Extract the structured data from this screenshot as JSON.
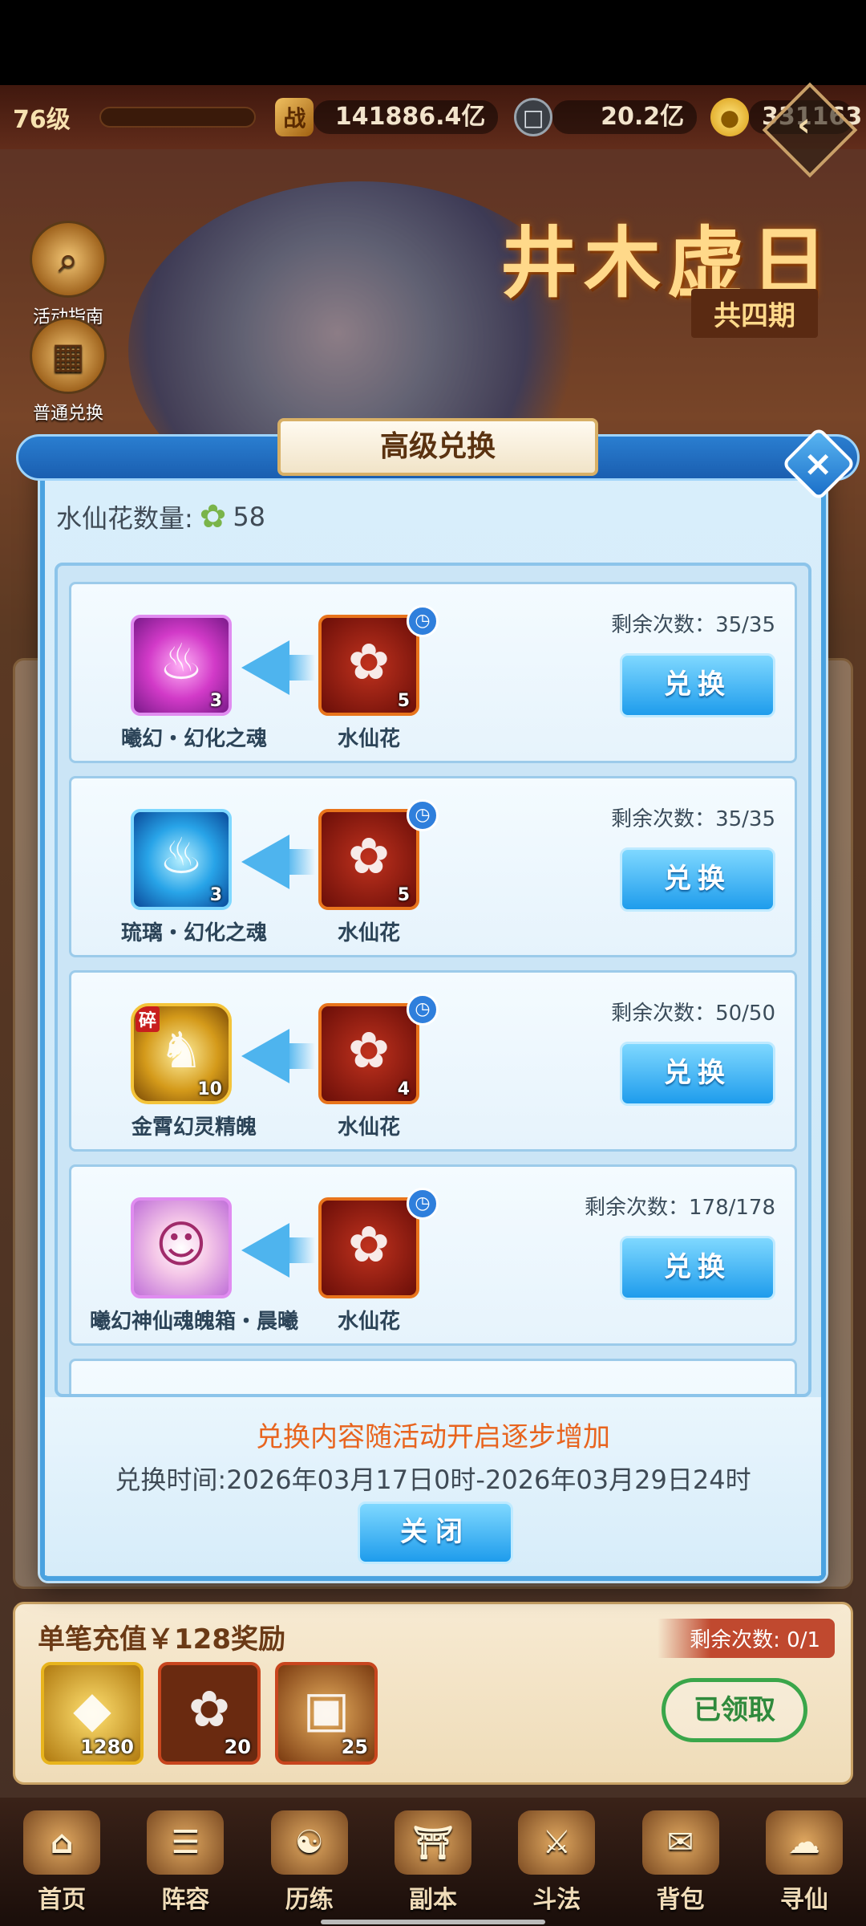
{
  "topbar": {
    "level": "76级",
    "power_value": "141886.4亿",
    "coin_value": "20.2亿",
    "gold_value": "331163"
  },
  "event": {
    "title": "井木虚日",
    "subtitle": "共四期",
    "left_icons": [
      "活动指南",
      "普通兑换"
    ]
  },
  "modal": {
    "title": "高级兑换",
    "flower_label": "水仙花数量:",
    "flower_count": "58",
    "exchange_button": "兑换",
    "rows": [
      {
        "target_name": "曦幻・幻化之魂",
        "target_count": "3",
        "cost_name": "水仙花",
        "cost_count": "5",
        "remain": "剩余次数：35/35"
      },
      {
        "target_name": "琉璃・幻化之魂",
        "target_count": "3",
        "cost_name": "水仙花",
        "cost_count": "5",
        "remain": "剩余次数：35/35"
      },
      {
        "target_name": "金霄幻灵精魄",
        "target_count": "10",
        "target_tag": "碎",
        "cost_name": "水仙花",
        "cost_count": "4",
        "remain": "剩余次数：50/50"
      },
      {
        "target_name": "曦幻神仙魂魄箱・晨曦",
        "target_count": "",
        "cost_name": "水仙花",
        "cost_count": "",
        "remain": "剩余次数：178/178"
      }
    ],
    "notice": "兑换内容随活动开启逐步增加",
    "time_text": "兑换时间:2026年03月17日0时-2026年03月29日24时",
    "close_label": "关闭"
  },
  "reward": {
    "title": "单笔充值￥128奖励",
    "remain": "剩余次数: 0/1",
    "items": [
      {
        "icon": "gold-ingot-icon",
        "count": "1280"
      },
      {
        "icon": "narcissus-icon",
        "count": "20"
      },
      {
        "icon": "treasure-chest-icon",
        "count": "25"
      }
    ],
    "claimed_label": "已领取"
  },
  "nav": [
    "首页",
    "阵容",
    "历练",
    "副本",
    "斗法",
    "背包",
    "寻仙"
  ]
}
